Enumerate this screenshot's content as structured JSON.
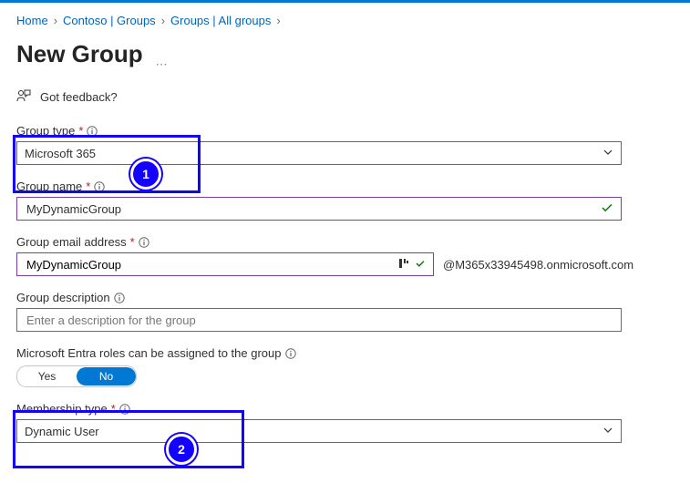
{
  "breadcrumb": {
    "items": [
      "Home",
      "Contoso | Groups",
      "Groups | All groups"
    ]
  },
  "page_title": "New Group",
  "feedback_label": "Got feedback?",
  "fields": {
    "group_type": {
      "label": "Group type",
      "required_marker": "*",
      "value": "Microsoft 365"
    },
    "group_name": {
      "label": "Group name",
      "required_marker": "*",
      "value": "MyDynamicGroup"
    },
    "group_email": {
      "label": "Group email address",
      "required_marker": "*",
      "value": "MyDynamicGroup",
      "domain": "@M365x33945498.onmicrosoft.com"
    },
    "group_description": {
      "label": "Group description",
      "placeholder": "Enter a description for the group",
      "value": ""
    },
    "entra_roles": {
      "label": "Microsoft Entra roles can be assigned to the group",
      "yes": "Yes",
      "no": "No",
      "selected": "No"
    },
    "membership_type": {
      "label": "Membership type",
      "required_marker": "*",
      "value": "Dynamic User"
    }
  },
  "annotations": {
    "1": "1",
    "2": "2"
  }
}
